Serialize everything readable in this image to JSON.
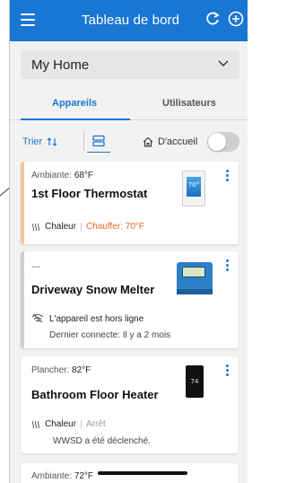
{
  "header": {
    "title": "Tableau de bord"
  },
  "home_select": {
    "value": "My Home"
  },
  "tabs": [
    {
      "label": "Appareils",
      "active": true
    },
    {
      "label": "Utilisateurs",
      "active": false
    }
  ],
  "controls": {
    "sort_label": "Trier",
    "home_label": "D'accueil",
    "home_toggle_on": false
  },
  "cards": [
    {
      "sensor_label": "Ambiante:",
      "sensor_value": "68°F",
      "name": "1st Floor Thermostat",
      "mode": "Chaleur",
      "action": "Chauffer: 70°F",
      "stripe_color": "#f3c69a",
      "image_text": "70°"
    },
    {
      "sensor_label": "---",
      "name": "Driveway Snow Melter",
      "status": "L'appareil est hors ligne",
      "last_connected": "Dernier connecte: Il y a 2 mois",
      "stripe_color": "#cfcfcf"
    },
    {
      "sensor_label": "Plancher:",
      "sensor_value": "82°F",
      "name": "Bathroom Floor Heater",
      "mode": "Chaleur",
      "action": "Arrêt",
      "alert": "WWSD a été déclenché.",
      "image_text": "74"
    },
    {
      "sensor_label": "Ambiante:",
      "sensor_value": "72°F"
    }
  ],
  "colors": {
    "accent": "#1976d2",
    "heat_action": "#e06b1f",
    "off_text": "#999999"
  }
}
